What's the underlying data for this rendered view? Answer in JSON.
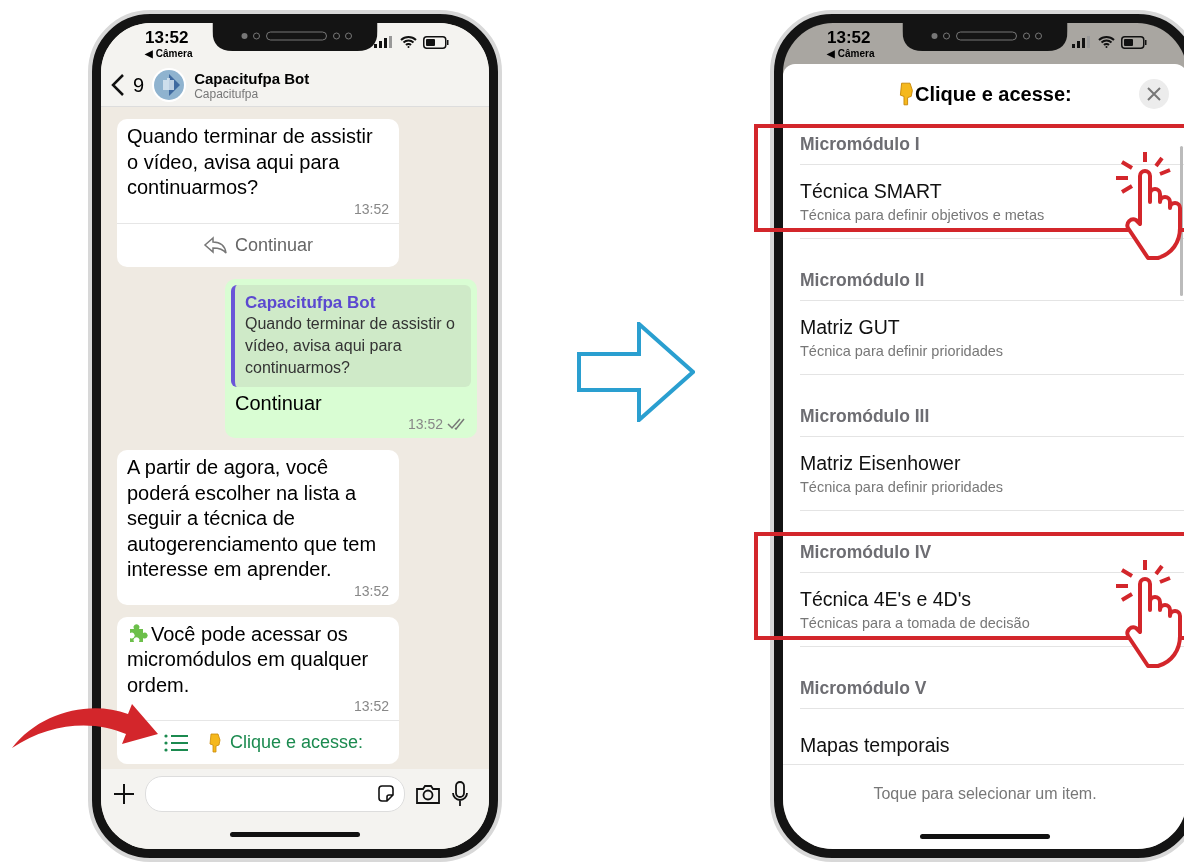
{
  "left_phone": {
    "status_bar": {
      "time": "13:52",
      "back_app": "◀ Câmera"
    },
    "chat_header": {
      "back_count": "9",
      "name": "Capacitufpa Bot",
      "subtitle": "Capacitufpa"
    },
    "messages": [
      {
        "kind": "incoming",
        "text": "Quando terminar de assistir o vídeo, avisa aqui para continuarmos?",
        "time": "13:52",
        "button": {
          "kind": "reply",
          "label": "Continuar"
        }
      },
      {
        "kind": "outgoing",
        "quote": {
          "author": "Capacitufpa Bot",
          "text": "Quando terminar de assistir o vídeo, avisa aqui para continuarmos?"
        },
        "text": "Continuar",
        "time": "13:52",
        "read": true
      },
      {
        "kind": "incoming",
        "text": "A partir de agora, você poderá escolher na lista a seguir a técnica de autogerenciamento que tem interesse em aprender.",
        "time": "13:52"
      },
      {
        "kind": "incoming",
        "leading_icon": {
          "kind": "puzzle"
        },
        "text": "Você pode acessar os micromódulos em qualquer ordem.",
        "time": "13:52",
        "button": {
          "kind": "list",
          "label": "Clique e acesse:"
        }
      }
    ]
  },
  "right_phone": {
    "status_bar": {
      "time": "13:52",
      "back_app": "◀ Câmera"
    },
    "sheet": {
      "title": "Clique e acesse:",
      "sections": [
        {
          "header": "Micromódulo I",
          "title": "Técnica SMART",
          "subtitle": "Técnica para definir objetivos e metas",
          "highlighted": true
        },
        {
          "header": "Micromódulo II",
          "title": "Matriz GUT",
          "subtitle": "Técnica para definir prioridades",
          "highlighted": false
        },
        {
          "header": "Micromódulo III",
          "title": "Matriz Eisenhower",
          "subtitle": "Técnica para definir prioridades",
          "highlighted": false
        },
        {
          "header": "Micromódulo IV",
          "title": "Técnica 4E's e 4D's",
          "subtitle": "Técnicas para a tomada de decisão",
          "highlighted": true
        },
        {
          "header": "Micromódulo V",
          "title": "Mapas temporais",
          "highlighted": false
        }
      ],
      "footer": "Toque para selecionar um item."
    }
  }
}
